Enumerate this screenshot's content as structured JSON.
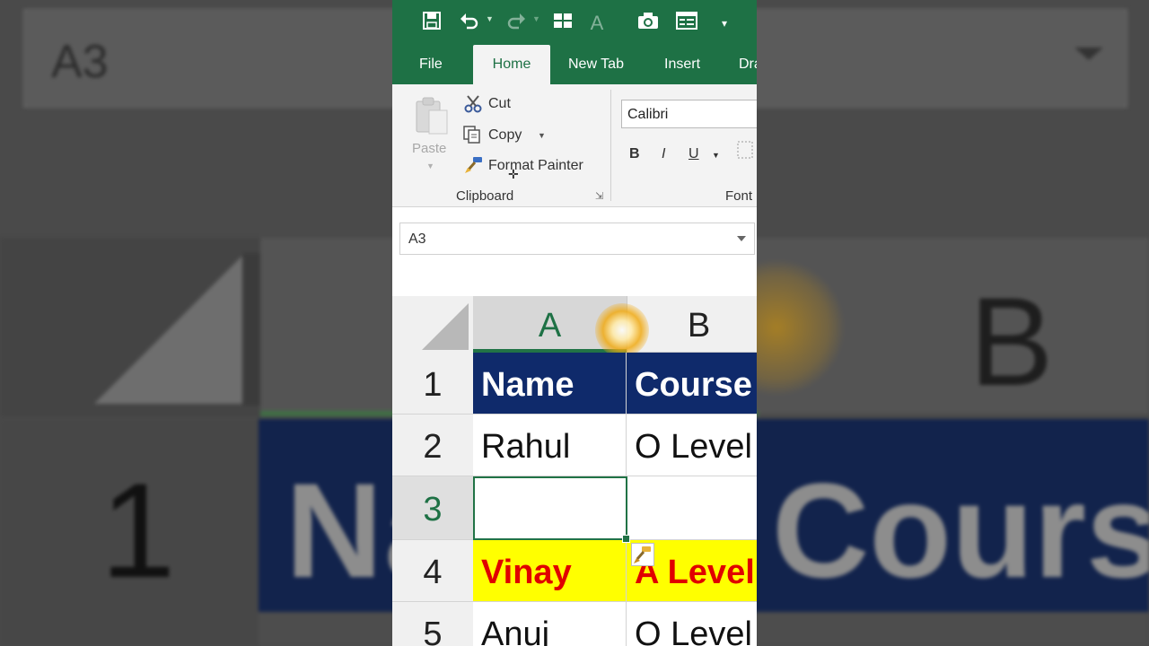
{
  "background": {
    "name_box": "A3",
    "col_b": "B",
    "row_1": "1",
    "cell_a1_partial": "Na",
    "cell_b1_partial": "Course"
  },
  "qat": {
    "icons": [
      "save-icon",
      "undo-icon",
      "redo-icon",
      "borders-icon",
      "font-color-icon",
      "camera-icon",
      "form-icon",
      "customize-icon"
    ]
  },
  "tabs": [
    {
      "label": "File"
    },
    {
      "label": "Home"
    },
    {
      "label": "New Tab"
    },
    {
      "label": "Insert"
    },
    {
      "label": "Dra"
    }
  ],
  "ribbon": {
    "paste_label": "Paste",
    "cut_label": "Cut",
    "copy_label": "Copy",
    "format_painter_label": "Format Painter",
    "clipboard_group_label": "Clipboard",
    "font_group_label": "Font",
    "font_name": "Calibri",
    "bold": "B",
    "italic": "I",
    "underline": "U"
  },
  "name_box": {
    "value": "A3"
  },
  "grid": {
    "columns": [
      "A",
      "B"
    ],
    "rows": [
      {
        "num": "1",
        "a": "Name",
        "b": "Course",
        "style": "hdr"
      },
      {
        "num": "2",
        "a": "Rahul",
        "b": "O Level",
        "style": "plain"
      },
      {
        "num": "3",
        "a": "",
        "b": "",
        "style": "plain"
      },
      {
        "num": "4",
        "a": "Vinay",
        "b": "A Level",
        "style": "yel"
      },
      {
        "num": "5",
        "a": "Anuj",
        "b": "O Level",
        "style": "plain"
      }
    ]
  },
  "colors": {
    "excel_green": "#1e7145",
    "header_fill": "#0f2a6b",
    "highlight_fill": "#ffff00",
    "highlight_text": "#e00000"
  }
}
